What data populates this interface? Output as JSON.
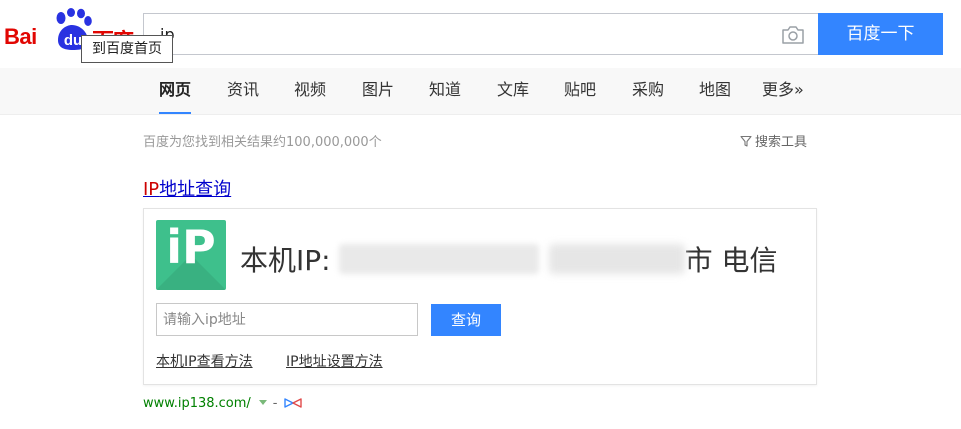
{
  "header": {
    "logo_latin_bai": "Bai",
    "logo_latin_du": "du",
    "logo_cn": "百度",
    "tooltip": "到百度首页",
    "search_value": "ip",
    "search_button": "百度一下",
    "accent_color": "#3385ff",
    "brand_color": "#e10602"
  },
  "nav": {
    "items": [
      {
        "label": "网页",
        "active": true
      },
      {
        "label": "资讯"
      },
      {
        "label": "视频"
      },
      {
        "label": "图片"
      },
      {
        "label": "知道"
      },
      {
        "label": "文库"
      },
      {
        "label": "贴吧"
      },
      {
        "label": "采购"
      },
      {
        "label": "地图"
      },
      {
        "label": "更多»"
      }
    ]
  },
  "results": {
    "count_text": "百度为您找到相关结果约100,000,000个",
    "tools_label": "搜索工具",
    "title_em": "IP",
    "title_rest": "地址查询",
    "card": {
      "logo_text": "iP",
      "ip_prefix": "本机IP:",
      "ip_suffix": "市 电信",
      "input_placeholder": "请输入ip地址",
      "query_button": "查询",
      "link1": "本机IP查看方法",
      "link2": "IP地址设置方法",
      "logo_color": "#3ec08c"
    },
    "source_url": "www.ip138.com/",
    "source_dash": "-"
  }
}
